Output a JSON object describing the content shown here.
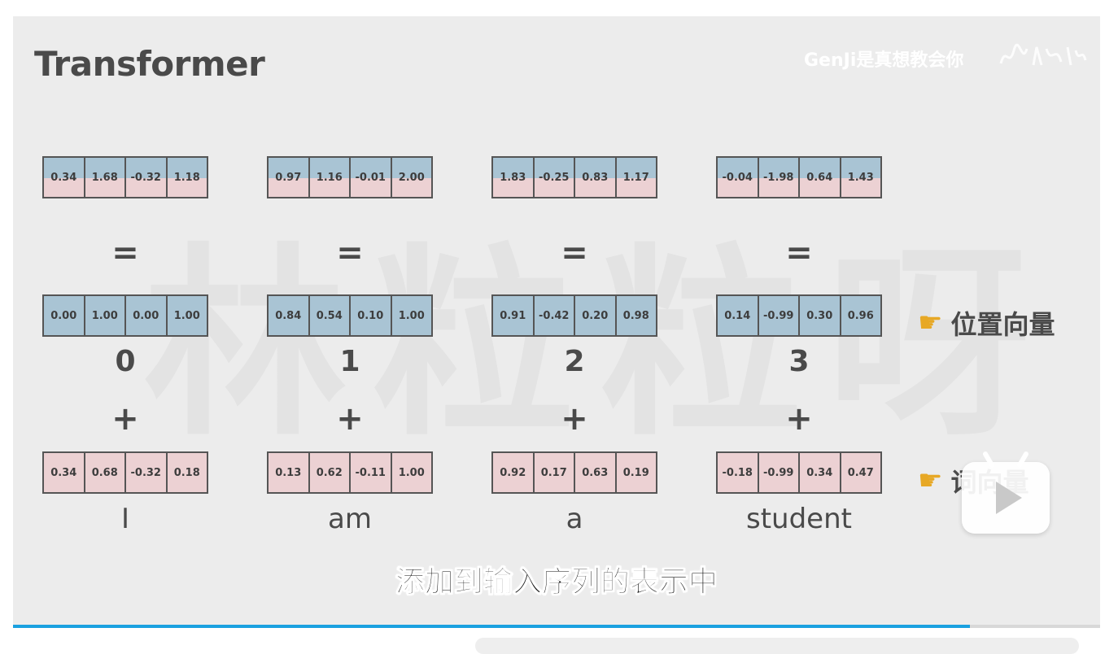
{
  "slide": {
    "title": "Transformer",
    "watermark_text": "林粒粒呀",
    "channel_watermark": "GenJi是真想教会你",
    "subtitle": "添加到输入序列的表示中",
    "progress_percent": 88
  },
  "columns": [
    {
      "result": [
        "0.34",
        "1.68",
        "-0.32",
        "1.18"
      ],
      "equals": "=",
      "positional": [
        "0.00",
        "1.00",
        "0.00",
        "1.00"
      ],
      "position_index": "0",
      "plus": "+",
      "word_embedding": [
        "0.34",
        "0.68",
        "-0.32",
        "0.18"
      ],
      "word": "I"
    },
    {
      "result": [
        "0.97",
        "1.16",
        "-0.01",
        "2.00"
      ],
      "equals": "=",
      "positional": [
        "0.84",
        "0.54",
        "0.10",
        "1.00"
      ],
      "position_index": "1",
      "plus": "+",
      "word_embedding": [
        "0.13",
        "0.62",
        "-0.11",
        "1.00"
      ],
      "word": "am"
    },
    {
      "result": [
        "1.83",
        "-0.25",
        "0.83",
        "1.17"
      ],
      "equals": "=",
      "positional": [
        "0.91",
        "-0.42",
        "0.20",
        "0.98"
      ],
      "position_index": "2",
      "plus": "+",
      "word_embedding": [
        "0.92",
        "0.17",
        "0.63",
        "0.19"
      ],
      "word": "a"
    },
    {
      "result": [
        "-0.04",
        "-1.98",
        "0.64",
        "1.43"
      ],
      "equals": "=",
      "positional": [
        "0.14",
        "-0.99",
        "0.30",
        "0.96"
      ],
      "position_index": "3",
      "plus": "+",
      "word_embedding": [
        "-0.18",
        "-0.99",
        "0.34",
        "0.47"
      ],
      "word": "student"
    }
  ],
  "side_labels": {
    "positional_vector": "位置向量",
    "word_vector": "词向量"
  },
  "icons": {
    "pointer": "pointing-hand-icon",
    "player": "play-badge-icon"
  },
  "colors": {
    "positional_cell": "#a9c4d4",
    "word_cell": "#ecd1d3",
    "progress": "#1aa1e0"
  }
}
